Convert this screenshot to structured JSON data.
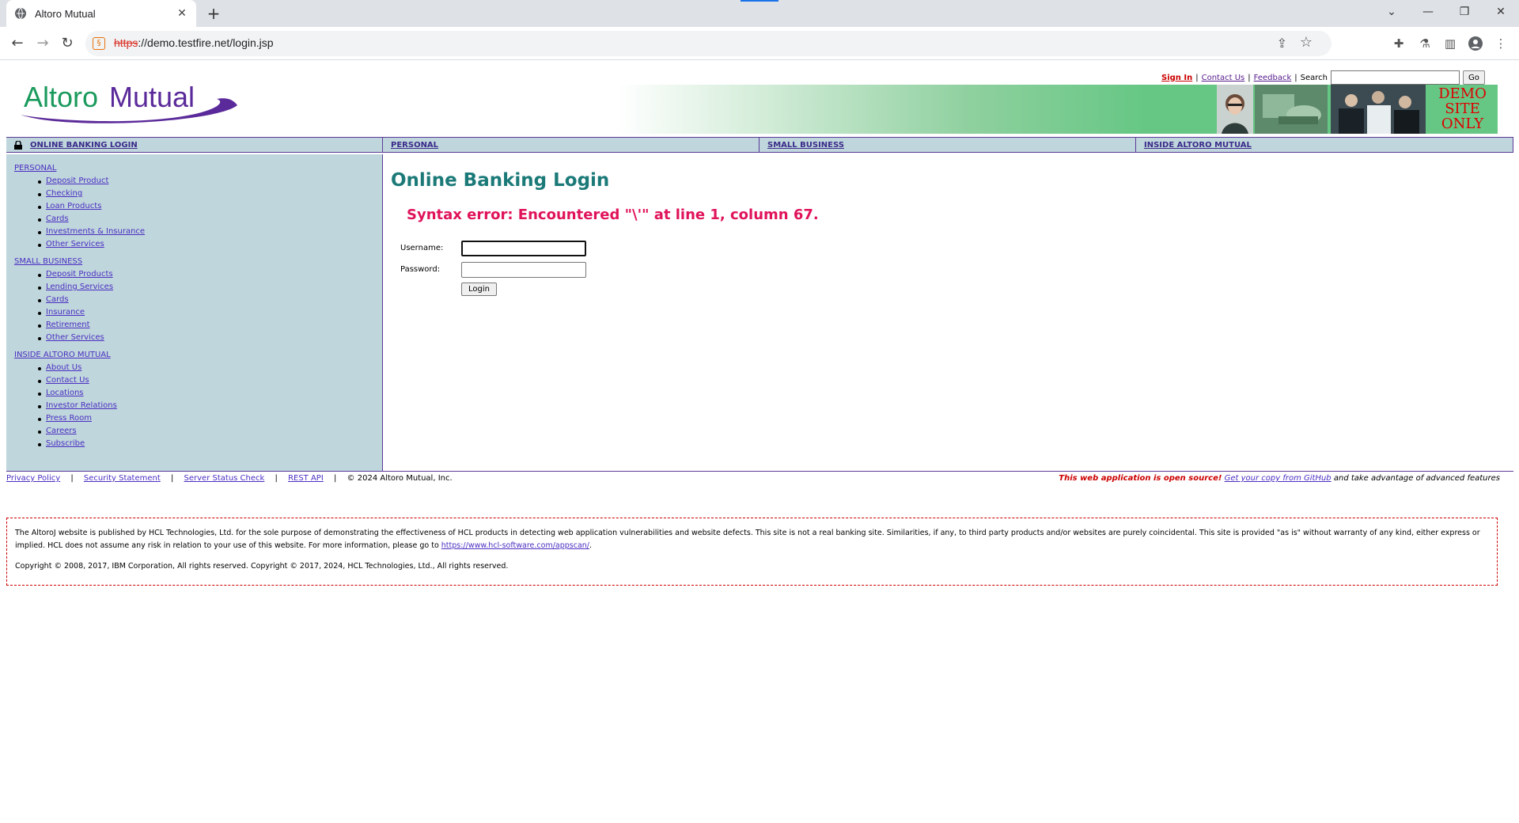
{
  "browser": {
    "tab_title": "Altoro Mutual",
    "tab_close": "✕",
    "new_tab": "+",
    "url_scheme": "https",
    "url_rest": "://demo.testfire.net/login.jsp",
    "min": "—",
    "restore": "❐",
    "close": "✕",
    "collapse": "⌄"
  },
  "header": {
    "logo_part1": "Altoro",
    "logo_part2": "Mutual",
    "sign_in": "Sign In",
    "contact_us": "Contact Us",
    "feedback": "Feedback",
    "search_label": "Search",
    "search_value": "",
    "go": "Go",
    "demo_line1": "DEMO",
    "demo_line2": "SITE",
    "demo_line3": "ONLY",
    "sep": "|"
  },
  "tabs": [
    {
      "label": "ONLINE BANKING LOGIN"
    },
    {
      "label": "PERSONAL"
    },
    {
      "label": "SMALL BUSINESS"
    },
    {
      "label": "INSIDE ALTORO MUTUAL"
    }
  ],
  "sidebar": {
    "personal": {
      "title": "PERSONAL",
      "items": [
        "Deposit Product",
        "Checking",
        "Loan Products",
        "Cards",
        "Investments & Insurance",
        "Other Services"
      ]
    },
    "small_business": {
      "title": "SMALL BUSINESS",
      "items": [
        "Deposit Products",
        "Lending Services",
        "Cards",
        "Insurance",
        "Retirement",
        "Other Services"
      ]
    },
    "inside": {
      "title": "INSIDE ALTORO MUTUAL",
      "items": [
        "About Us",
        "Contact Us",
        "Locations",
        "Investor Relations",
        "Press Room",
        "Careers",
        "Subscribe"
      ]
    }
  },
  "main": {
    "title": "Online Banking Login",
    "error": "Syntax error: Encountered \"\\'\" at line 1, column 67.",
    "username_label": "Username:",
    "password_label": "Password:",
    "username_value": "",
    "password_value": "",
    "login_button": "Login"
  },
  "footer": {
    "privacy": "Privacy Policy",
    "security": "Security Statement",
    "status": "Server Status Check",
    "rest": "REST API",
    "copyright": "© 2024 Altoro Mutual, Inc.",
    "pipe": "|",
    "open_source": "This web application is open source!",
    "github": "Get your copy from GitHub",
    "advantage": " and take advantage of advanced features"
  },
  "disclaimer": {
    "text1": "The AltoroJ website is published by HCL Technologies, Ltd. for the sole purpose of demonstrating the effectiveness of HCL products in detecting web application vulnerabilities and website defects. This site is not a real banking site. Similarities, if any, to third party products and/or websites are purely coincidental. This site is provided \"as is\" without warranty of any kind, either express or implied. HCL does not assume any risk in relation to your use of this website. For more information, please go to ",
    "link": "https://www.hcl-software.com/appscan/",
    "text2": ".",
    "copyright": "Copyright © 2008, 2017, IBM Corporation, All rights reserved. Copyright © 2017, 2024, HCL Technologies, Ltd., All rights reserved."
  },
  "colors": {
    "nav_bg": "#bfd6dc",
    "border_purple": "#5b3a9a",
    "title_teal": "#1b7a78",
    "error_pink": "#e0135a",
    "logo_green": "#1a9a5c",
    "logo_purple": "#5b2a9a"
  }
}
